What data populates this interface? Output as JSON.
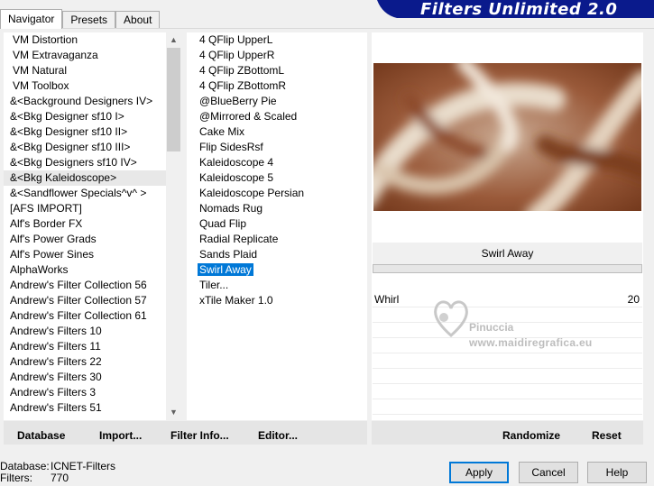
{
  "brand": {
    "title": "Filters Unlimited 2.0"
  },
  "tabs": [
    {
      "label": "Navigator",
      "active": true
    },
    {
      "label": "Presets",
      "active": false
    },
    {
      "label": "About",
      "active": false
    }
  ],
  "categories": [
    {
      "label": "VM Distortion"
    },
    {
      "label": "VM Extravaganza"
    },
    {
      "label": "VM Natural"
    },
    {
      "label": "VM Toolbox"
    },
    {
      "label": "&<Background Designers IV>"
    },
    {
      "label": "&<Bkg Designer sf10 I>"
    },
    {
      "label": "&<Bkg Designer sf10 II>"
    },
    {
      "label": "&<Bkg Designer sf10 III>"
    },
    {
      "label": "&<Bkg Designers sf10 IV>"
    },
    {
      "label": "&<Bkg Kaleidoscope>",
      "selected": true
    },
    {
      "label": "&<Sandflower Specials^v^ >"
    },
    {
      "label": "[AFS IMPORT]"
    },
    {
      "label": "Alf's Border FX"
    },
    {
      "label": "Alf's Power Grads"
    },
    {
      "label": "Alf's Power Sines"
    },
    {
      "label": "AlphaWorks"
    },
    {
      "label": "Andrew's Filter Collection 56"
    },
    {
      "label": "Andrew's Filter Collection 57"
    },
    {
      "label": "Andrew's Filter Collection 61"
    },
    {
      "label": "Andrew's Filters 10"
    },
    {
      "label": "Andrew's Filters 11"
    },
    {
      "label": "Andrew's Filters 22"
    },
    {
      "label": "Andrew's Filters 30"
    },
    {
      "label": "Andrew's Filters 3"
    },
    {
      "label": "Andrew's Filters 51"
    }
  ],
  "filters": [
    {
      "label": "4 QFlip UpperL"
    },
    {
      "label": "4 QFlip UpperR"
    },
    {
      "label": "4 QFlip ZBottomL"
    },
    {
      "label": "4 QFlip ZBottomR"
    },
    {
      "label": "@BlueBerry Pie"
    },
    {
      "label": "@Mirrored & Scaled"
    },
    {
      "label": "Cake Mix"
    },
    {
      "label": "Flip SidesRsf"
    },
    {
      "label": "Kaleidoscope 4"
    },
    {
      "label": "Kaleidoscope 5"
    },
    {
      "label": "Kaleidoscope Persian"
    },
    {
      "label": "Nomads Rug"
    },
    {
      "label": "Quad Flip"
    },
    {
      "label": "Radial Replicate"
    },
    {
      "label": "Sands Plaid"
    },
    {
      "label": "Swirl Away",
      "selected": true
    },
    {
      "label": "Tiler..."
    },
    {
      "label": "xTile Maker 1.0"
    }
  ],
  "selected_filter": {
    "name": "Swirl Away"
  },
  "parameters": [
    {
      "name": "Whirl",
      "value": "20"
    }
  ],
  "watermark": {
    "name": "Pinuccia",
    "url": "www.maidiregrafica.eu"
  },
  "buttons": {
    "database": "Database",
    "import": "Import...",
    "filter_info": "Filter Info...",
    "editor": "Editor...",
    "randomize": "Randomize",
    "reset": "Reset",
    "apply": "Apply",
    "cancel": "Cancel",
    "help": "Help"
  },
  "status": {
    "database_label": "Database:",
    "database_value": "ICNET-Filters",
    "filters_label": "Filters:",
    "filters_value": "770"
  },
  "colors": {
    "brand_blue": "#0a1a8c",
    "selection": "#0078d7"
  }
}
